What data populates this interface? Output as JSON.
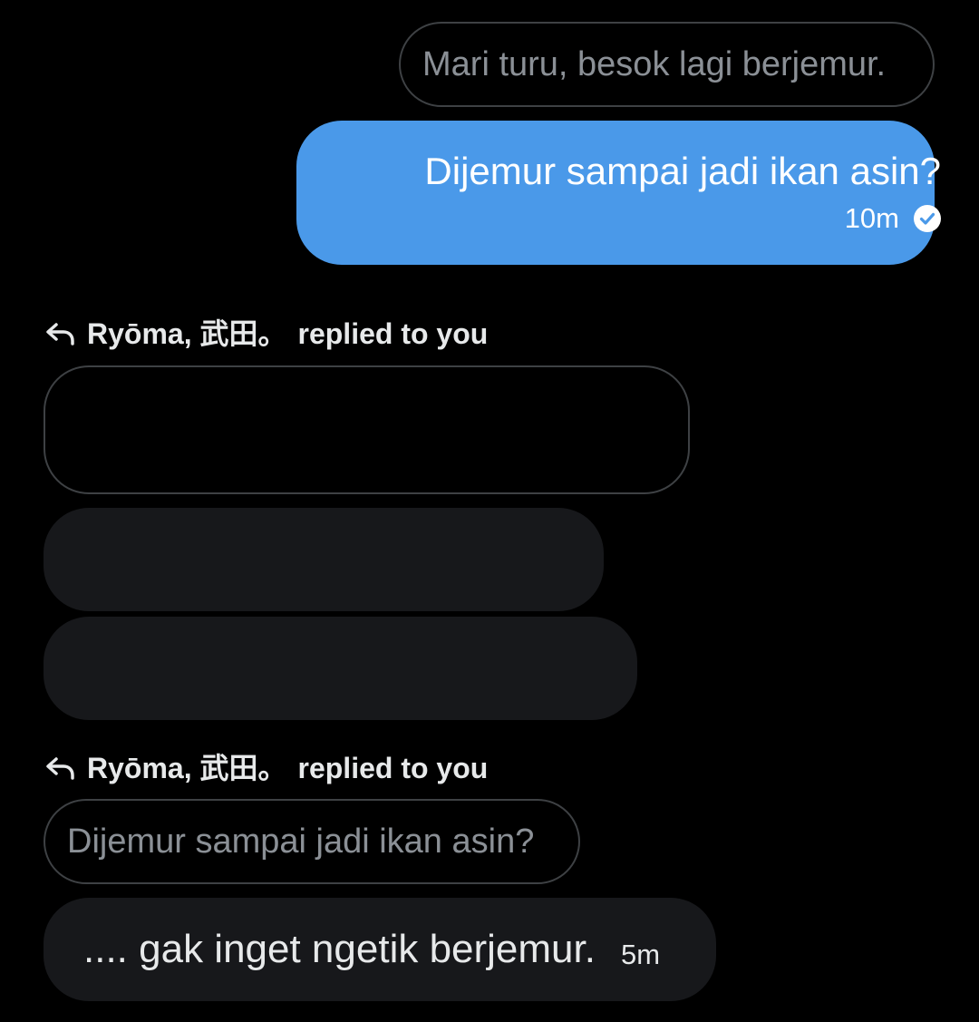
{
  "messages": {
    "quote_top": "Mari turu, besok lagi berjemur.",
    "sent": {
      "text": "Dijemur sampai jadi ikan asin?",
      "time": "10m",
      "status_icon": "check-circle-icon"
    },
    "reply_1": {
      "label_name": "Ryōma, 武田。",
      "label_suffix": "replied to you",
      "icon": "reply-arrow-icon"
    },
    "reply_2": {
      "label_name": "Ryōma, 武田。",
      "label_suffix": "replied to you",
      "icon": "reply-arrow-icon",
      "quote": "Dijemur sampai jadi ikan asin?",
      "text": ".... gak inget ngetik berjemur.",
      "time": "5m"
    }
  },
  "colors": {
    "background": "#000000",
    "sent_bubble": "#4a99e9",
    "received_bubble": "#17181b",
    "quote_border": "#3e4144",
    "quote_text": "#8b9096"
  }
}
